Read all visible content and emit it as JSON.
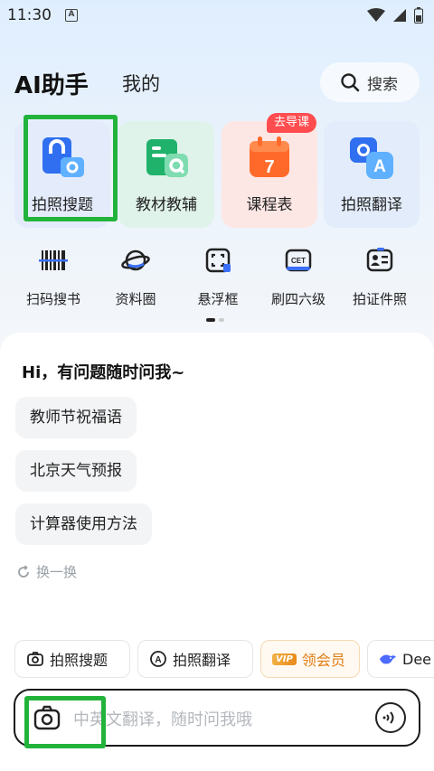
{
  "status_bar": {
    "time": "11:30",
    "notif": "A"
  },
  "header": {
    "title": "AI助手",
    "tab_mine": "我的",
    "search_label": "搜索"
  },
  "feature_cards": [
    {
      "label": "拍照搜题",
      "icon": "photo-search-icon"
    },
    {
      "label": "教材教辅",
      "icon": "textbook-icon"
    },
    {
      "label": "课程表",
      "icon": "calendar-icon",
      "badge": "去导课",
      "day": "7"
    },
    {
      "label": "拍照翻译",
      "icon": "photo-translate-icon"
    }
  ],
  "tools": [
    {
      "label": "扫码搜书",
      "icon": "barcode-icon"
    },
    {
      "label": "资料圈",
      "icon": "planet-icon"
    },
    {
      "label": "悬浮框",
      "icon": "floating-frame-icon"
    },
    {
      "label": "刷四六级",
      "icon": "cet-icon",
      "tag": "CET"
    },
    {
      "label": "拍证件照",
      "icon": "id-photo-icon"
    }
  ],
  "chat": {
    "greeting": "Hi，有问题随时问我~",
    "suggestions": [
      "教师节祝福语",
      "北京天气预报",
      "计算器使用方法"
    ],
    "refresh_label": "换一换"
  },
  "quick_actions": [
    {
      "label": "拍照搜题",
      "icon": "camera-icon"
    },
    {
      "label": "拍照翻译",
      "icon": "translate-icon"
    },
    {
      "label": "领会员",
      "icon": "vip-icon",
      "tag": "VIP"
    },
    {
      "label": "Dee",
      "icon": "deepseek-icon"
    }
  ],
  "input": {
    "placeholder": "中英文翻译，随时问我哦"
  },
  "colors": {
    "highlight": "#22b33b",
    "badge": "#ff4d4f",
    "vip": "#e07d12"
  }
}
